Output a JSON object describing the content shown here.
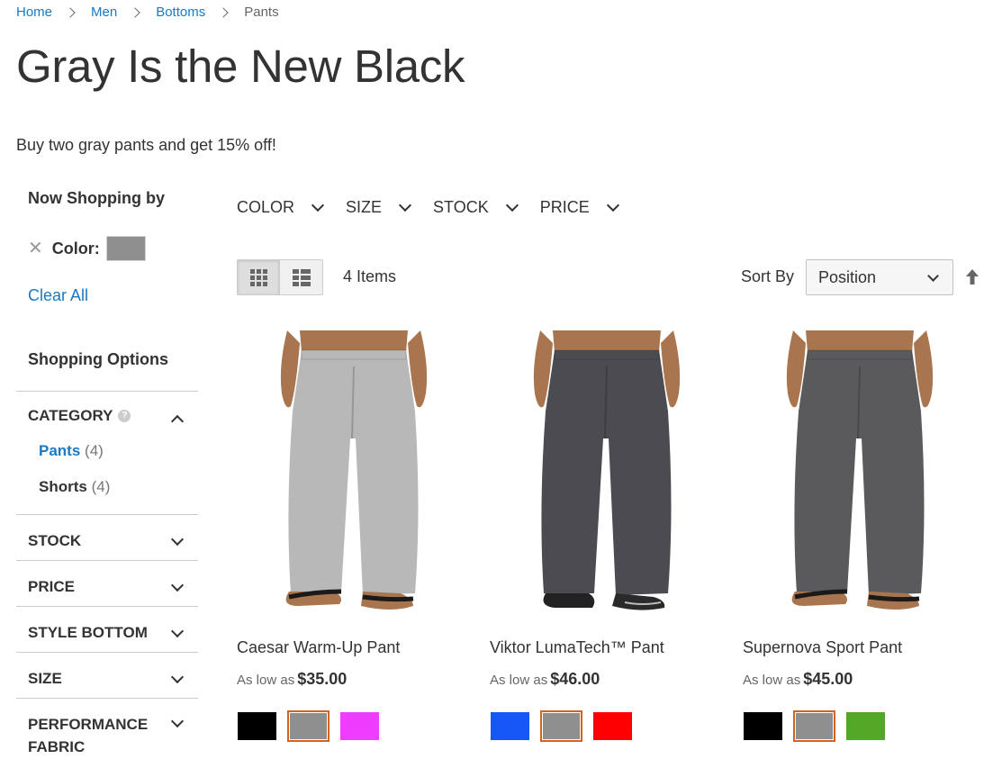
{
  "breadcrumbs": [
    "Home",
    "Men",
    "Bottoms",
    "Pants"
  ],
  "page_title": "Gray Is the New Black",
  "promo_text": "Buy two gray pants and get 15% off!",
  "sidebar": {
    "now_shopping_title": "Now Shopping by",
    "current_filter_label": "Color:",
    "current_filter_color": "#8f8f8f",
    "clear_all": "Clear All",
    "shopping_options_title": "Shopping Options",
    "facets": [
      {
        "title": "CATEGORY",
        "open": true,
        "items": [
          {
            "label": "Pants",
            "count": "(4)",
            "active": true
          },
          {
            "label": "Shorts",
            "count": "(4)",
            "active": false
          }
        ]
      },
      {
        "title": "STOCK"
      },
      {
        "title": "PRICE"
      },
      {
        "title": "STYLE BOTTOM"
      },
      {
        "title": "SIZE"
      },
      {
        "title": "PERFORMANCE FABRIC"
      }
    ]
  },
  "filter_bar": [
    "COLOR",
    "SIZE",
    "STOCK",
    "PRICE"
  ],
  "toolbar": {
    "items_count": "4 Items",
    "sort_label": "Sort By",
    "sort_value": "Position"
  },
  "products": [
    {
      "name": "Caesar Warm-Up Pant",
      "price_prefix": "As low as",
      "price": "$35.00",
      "pant_color": "#b8b8b8",
      "shoe": "sandal",
      "swatches": [
        "#000000",
        "#8f8f8f",
        "#ef3dff"
      ],
      "selected_swatch": 1
    },
    {
      "name": "Viktor LumaTech™ Pant",
      "price_prefix": "As low as",
      "price": "$46.00",
      "pant_color": "#4d4b52",
      "shoe": "sneaker",
      "swatches": [
        "#1857f7",
        "#8f8f8f",
        "#ff0000"
      ],
      "selected_swatch": 1
    },
    {
      "name": "Supernova Sport Pant",
      "price_prefix": "As low as",
      "price": "$45.00",
      "pant_color": "#5a5a5c",
      "shoe": "sandal",
      "swatches": [
        "#000000",
        "#8f8f8f",
        "#53a828"
      ],
      "selected_swatch": 1
    }
  ]
}
